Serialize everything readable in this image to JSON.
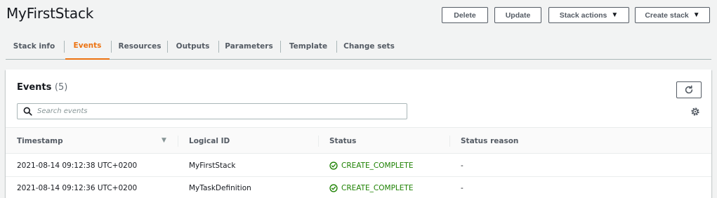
{
  "stack": {
    "title": "MyFirstStack"
  },
  "actions": {
    "delete": "Delete",
    "update": "Update",
    "stack_actions": "Stack actions",
    "create_stack": "Create stack"
  },
  "tabs": [
    "Stack info",
    "Events",
    "Resources",
    "Outputs",
    "Parameters",
    "Template",
    "Change sets"
  ],
  "active_tab": "Events",
  "events": {
    "title": "Events",
    "count": "(5)",
    "search_placeholder": "Search events",
    "columns": [
      "Timestamp",
      "Logical ID",
      "Status",
      "Status reason"
    ],
    "rows": [
      {
        "timestamp": "2021-08-14 09:12:38 UTC+0200",
        "logical_id": "MyFirstStack",
        "status": "CREATE_COMPLETE",
        "reason": "-"
      },
      {
        "timestamp": "2021-08-14 09:12:36 UTC+0200",
        "logical_id": "MyTaskDefinition",
        "status": "CREATE_COMPLETE",
        "reason": "-"
      }
    ]
  },
  "colors": {
    "accent": "#ec7211",
    "success": "#1d8102",
    "text": "#16191f",
    "muted": "#545b64"
  },
  "icons": {
    "refresh": "refresh-icon",
    "search": "search-icon",
    "settings": "settings-icon",
    "status": "check-circle-icon",
    "sort": "sort-descending-icon"
  }
}
